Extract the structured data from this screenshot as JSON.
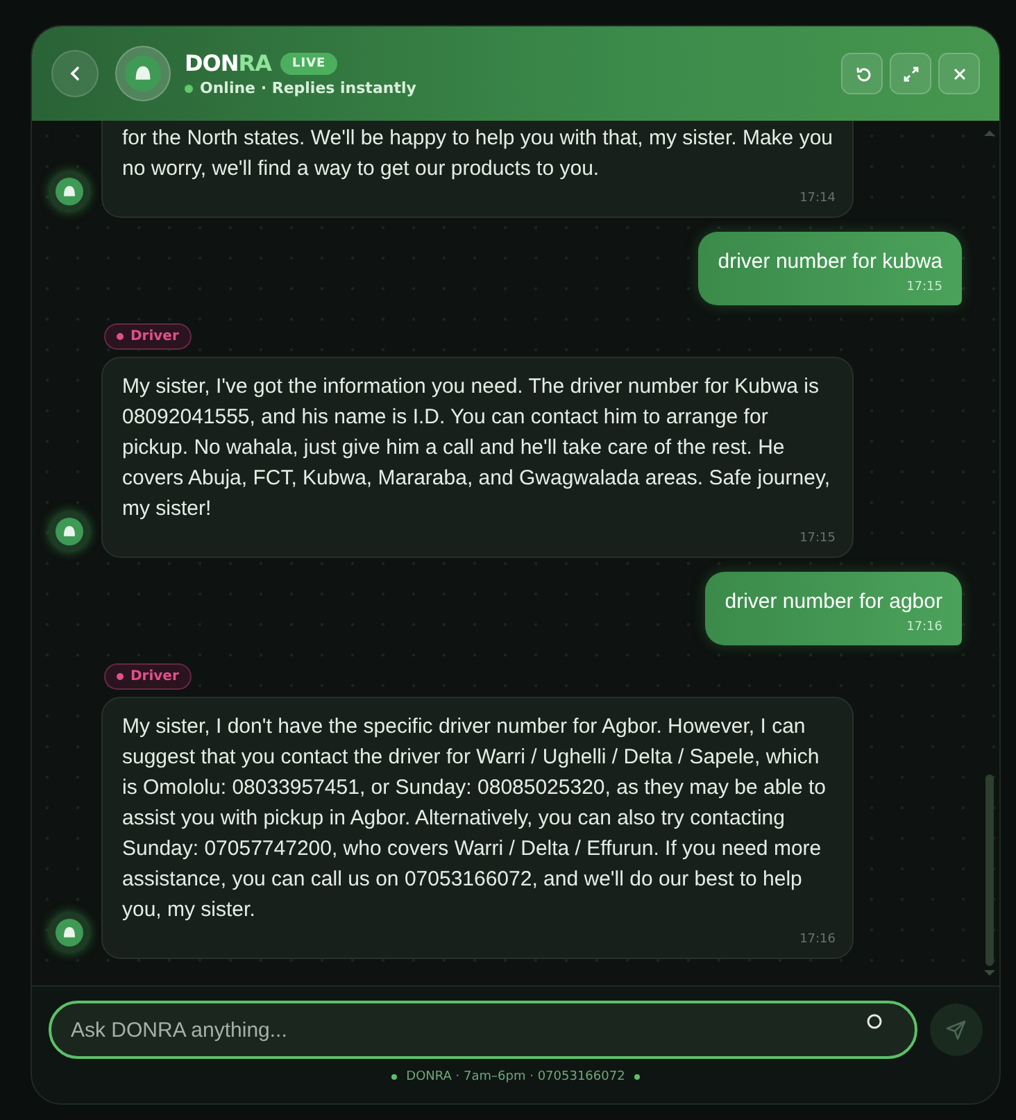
{
  "header": {
    "name": "DON",
    "name_accent": "RA",
    "badge": "LIVE",
    "status": "Online · Replies instantly"
  },
  "messages": [
    {
      "kind": "bot",
      "cut": true,
      "text": "for the North states. We'll be happy to help you with that, my sister. Make you no worry, we'll find a way to get our products to you.",
      "time": "17:14"
    },
    {
      "kind": "user",
      "text": "driver number for kubwa",
      "time": "17:15"
    },
    {
      "kind": "bot",
      "tag": {
        "label": "Driver",
        "color": "#e0508a"
      },
      "text": "My sister, I've got the information you need. The driver number for Kubwa is 08092041555, and his name is I.D. You can contact him to arrange for pickup. No wahala, just give him a call and he'll take care of the rest. He covers Abuja, FCT, Kubwa, Mararaba, and Gwagwalada areas. Safe journey, my sister!",
      "time": "17:15"
    },
    {
      "kind": "user",
      "text": "driver number for agbor",
      "time": "17:16"
    },
    {
      "kind": "bot",
      "tag": {
        "label": "Driver",
        "color": "#e0508a"
      },
      "text": "My sister, I don't have the specific driver number for Agbor. However, I can suggest that you contact the driver for Warri / Ughelli / Delta / Sapele, which is Omololu: 08033957451, or Sunday: 08085025320, as they may be able to assist you with pickup in Agbor. Alternatively, you can also try contacting Sunday: 07057747200, who covers Warri / Delta / Effurun. If you need more assistance, you can call us on 07053166072, and we'll do our best to help you, my sister.",
      "time": "17:16"
    }
  ],
  "input": {
    "placeholder": "Ask DONRA anything..."
  },
  "footer": "DONRA · 7am–6pm · 07053166072"
}
